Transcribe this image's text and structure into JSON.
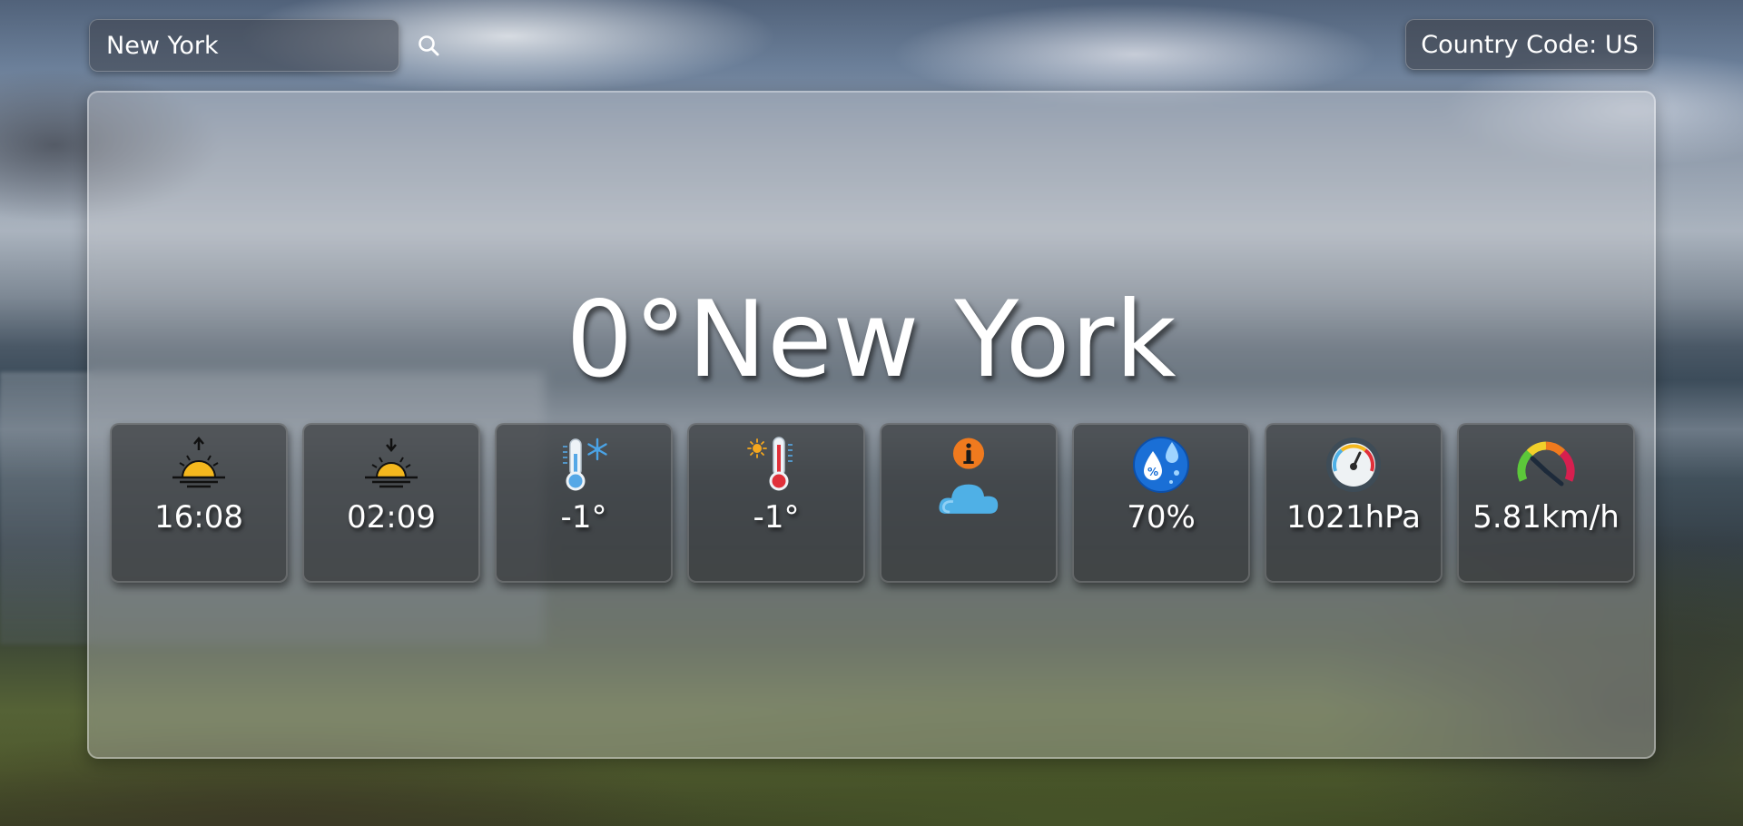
{
  "search": {
    "value": "New York",
    "icon": "search-icon"
  },
  "country": {
    "label": "Country Code: US"
  },
  "main": {
    "temperature": "0°",
    "city": "New York"
  },
  "cards": [
    {
      "icon": "sunrise-icon",
      "value": "16:08"
    },
    {
      "icon": "sunset-icon",
      "value": "02:09"
    },
    {
      "icon": "thermometer-cold-icon",
      "value": "-1°"
    },
    {
      "icon": "thermometer-hot-icon",
      "value": "-1°"
    },
    {
      "icon": "cloud-info-icon",
      "value": ""
    },
    {
      "icon": "humidity-icon",
      "value": "70%"
    },
    {
      "icon": "pressure-gauge-icon",
      "value": "1021hPa"
    },
    {
      "icon": "wind-speed-gauge-icon",
      "value": "5.81km/h"
    }
  ],
  "colors": {
    "sun": "#f5b81e",
    "ice": "#56a8e6",
    "heat": "#e0303a",
    "info": "#f07a1e",
    "cloud": "#4fb0e6",
    "drop": "#1a6fd6"
  }
}
